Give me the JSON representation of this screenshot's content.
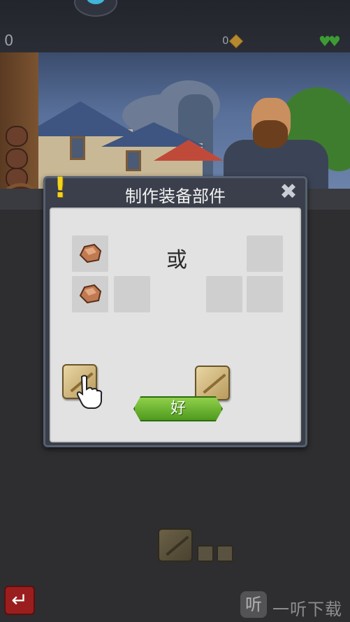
{
  "hud": {
    "score_left": "0",
    "gold_count": "0",
    "hearts": "♥♥"
  },
  "dialog": {
    "title": "制作装备部件",
    "close_symbol": "✖",
    "alert_symbol": "!",
    "or_text": "或",
    "ok_label": "好"
  },
  "watermark": {
    "icon": "听",
    "text": "一听下载"
  },
  "back_button": {
    "symbol": "↵"
  },
  "colors": {
    "accent_green": "#5aa82a",
    "heart_green": "#3d9b34",
    "alert_yellow": "#f5d21c",
    "back_red": "#9a1e1e"
  },
  "icons": [
    "mascot-icon",
    "gold-icon",
    "heart-icon",
    "alert-icon",
    "close-icon",
    "ore-icon",
    "plank-icon",
    "hand-pointer-icon",
    "back-icon"
  ]
}
